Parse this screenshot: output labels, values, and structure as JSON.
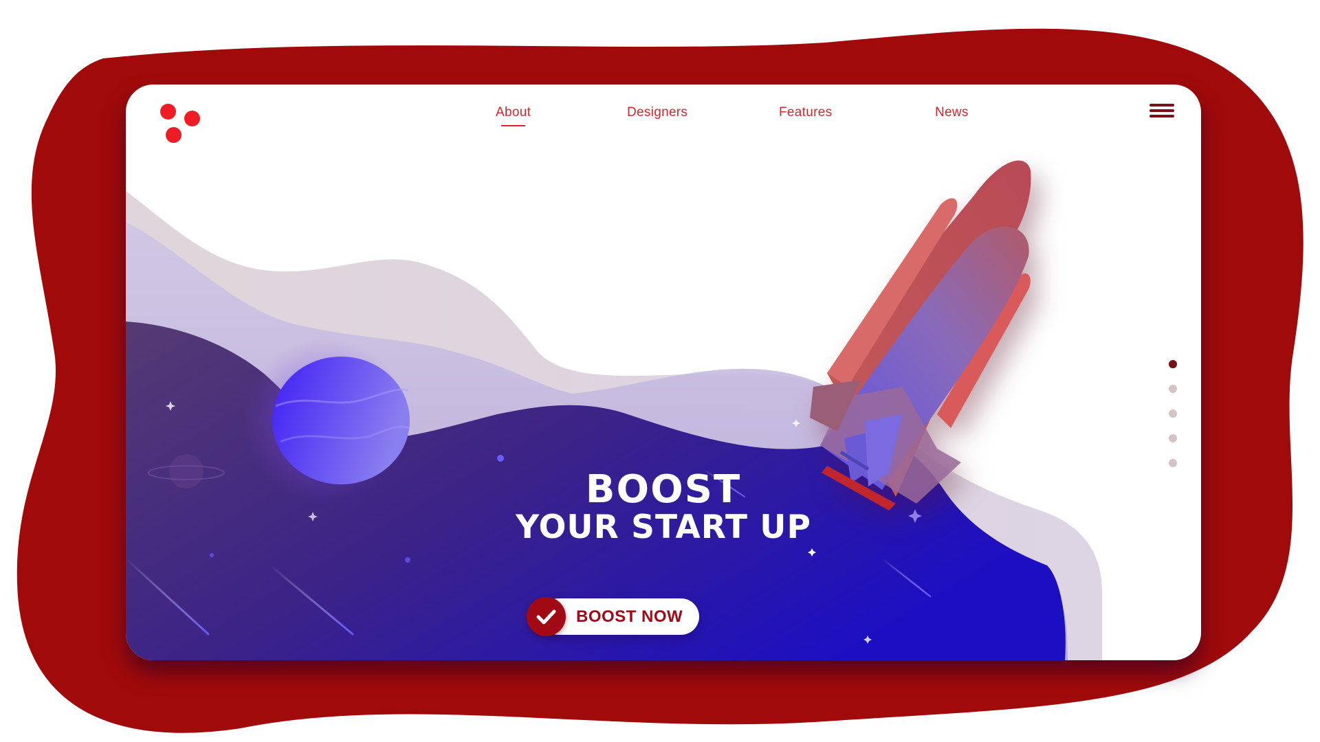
{
  "nav": {
    "items": [
      {
        "label": "About",
        "active": true
      },
      {
        "label": "Designers",
        "active": false
      },
      {
        "label": "Features",
        "active": false
      },
      {
        "label": "News",
        "active": false
      }
    ]
  },
  "hero": {
    "title_line1": "BOOST",
    "title_line2": "YOUR START UP",
    "cta_label": "BOOST NOW"
  },
  "slider": {
    "count": 5,
    "active_index": 0
  },
  "icons": [
    "logo-icon",
    "hamburger-menu-icon",
    "checkmark-icon",
    "planet-icon",
    "ringed-planet-icon",
    "rocket-illustration",
    "star-icon"
  ],
  "colors": {
    "brand_red": "#a10a14",
    "nav_red": "#d9232a",
    "logo_red": "#ee1c25",
    "space_blue": "#2a18c8",
    "space_purple": "#4a2a6e",
    "page_dot_active": "#7a1016",
    "page_dot_inactive": "#d6c3c8"
  }
}
